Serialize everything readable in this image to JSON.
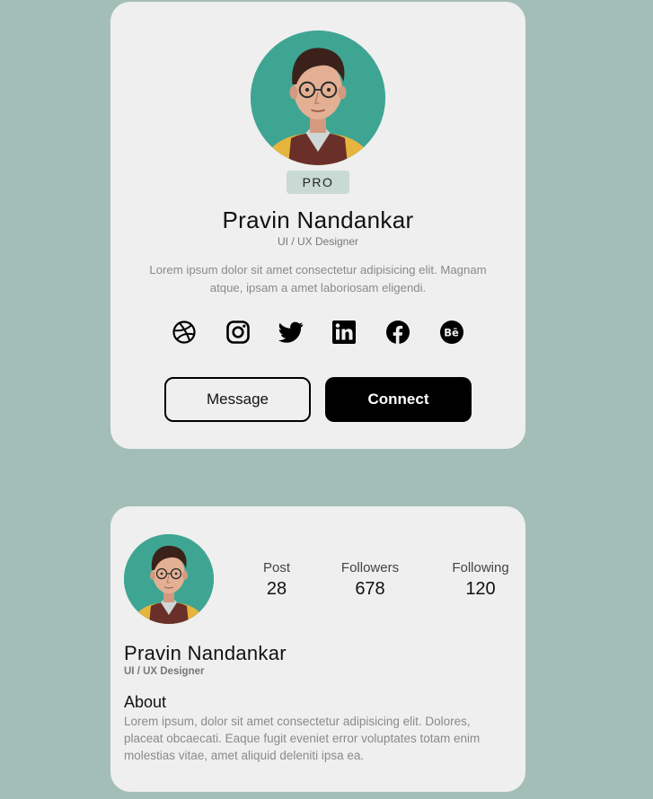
{
  "profile_card": {
    "badge": "PRO",
    "name": "Pravin Nandankar",
    "role": "UI / UX Designer",
    "bio": "Lorem ipsum dolor sit amet consectetur adipisicing elit. Magnam atque, ipsam a amet laboriosam eligendi.",
    "socials": [
      "dribbble-icon",
      "instagram-icon",
      "twitter-icon",
      "linkedin-icon",
      "facebook-icon",
      "behance-icon"
    ],
    "buttons": {
      "message": "Message",
      "connect": "Connect"
    }
  },
  "stats_card": {
    "name": "Pravin Nandankar",
    "role": "UI / UX Designer",
    "stats": [
      {
        "label": "Post",
        "value": "28"
      },
      {
        "label": "Followers",
        "value": "678"
      },
      {
        "label": "Following",
        "value": "120"
      }
    ],
    "about_title": "About",
    "about_text": "Lorem ipsum, dolor sit amet consectetur adipisicing elit. Dolores, placeat obcaecati. Eaque fugit eveniet error voluptates totam enim molestias vitae, amet aliquid deleniti ipsa ea."
  },
  "colors": {
    "page_background": "#a3beb6",
    "card_background": "#efefef",
    "badge_background": "#c9d9d3",
    "primary_button": "#000000"
  }
}
